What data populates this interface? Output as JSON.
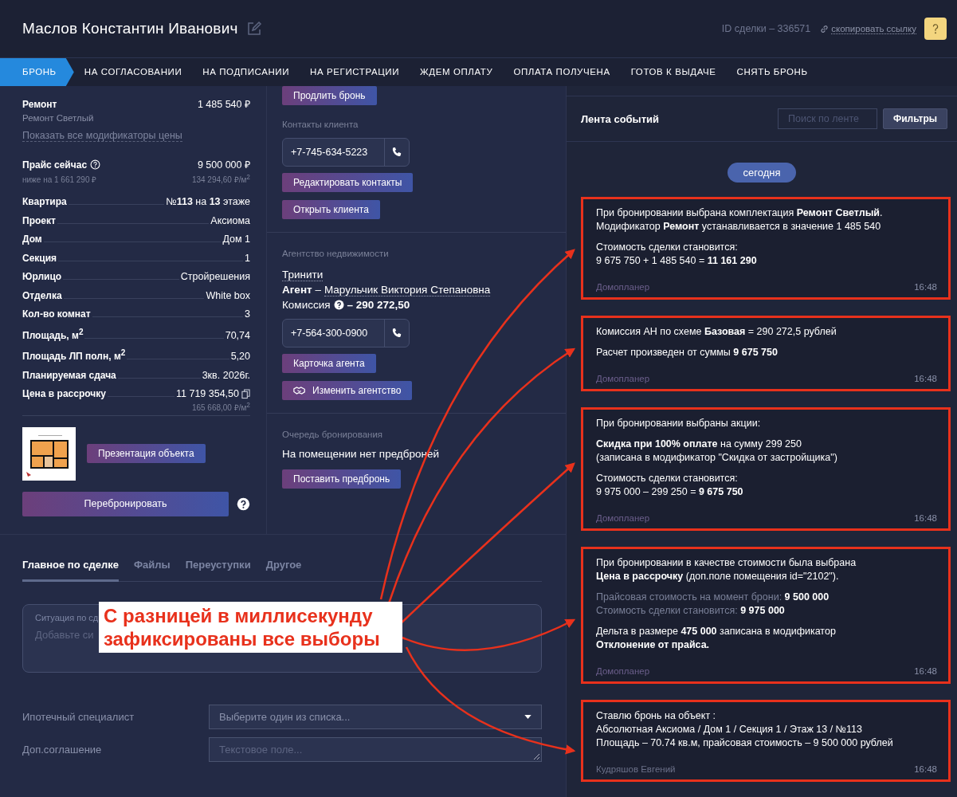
{
  "header": {
    "title": "Маслов Константин Иванович",
    "deal_id": "ID сделки – 336571",
    "copy_link": "скопировать ссылку"
  },
  "stages": [
    {
      "label": "БРОНЬ",
      "selected": true
    },
    {
      "label": "НА СОГЛАСОВАНИИ",
      "selected": false
    },
    {
      "label": "НА ПОДПИСАНИИ",
      "selected": false
    },
    {
      "label": "НА РЕГИСТРАЦИИ",
      "selected": false
    },
    {
      "label": "ЖДЕМ ОПЛАТУ",
      "selected": false
    },
    {
      "label": "ОПЛАТА ПОЛУЧЕНА",
      "selected": false
    },
    {
      "label": "ГОТОВ К ВЫДАЧЕ",
      "selected": false
    },
    {
      "label": "СНЯТЬ БРОНЬ",
      "selected": false
    }
  ],
  "left": {
    "modifier": {
      "label": "Ремонт",
      "value": "1 485 540 ₽",
      "sub": "Ремонт Светлый"
    },
    "show_modifiers": "Показать все модификаторы цены",
    "price": {
      "label": "Прайс сейчас",
      "value": "9 500 000 ₽",
      "note": "ниже на 1 661 290 ₽",
      "per_m2": "134 294,60 ₽/м$^{2}$"
    },
    "properties": [
      {
        "label": "Квартира",
        "value": "№**113** на **13** этаже"
      },
      {
        "label": "Проект",
        "value": "Аксиома"
      },
      {
        "label": "Дом",
        "value": "Дом 1"
      },
      {
        "label": "Секция",
        "value": "1"
      },
      {
        "label": "Юрлицо",
        "value": "Стройрешения"
      },
      {
        "label": "Отделка",
        "value": "White box"
      },
      {
        "label": "Кол-во комнат",
        "value": "3"
      },
      {
        "label": "Площадь, м$^{2}$",
        "value": "70,74"
      },
      {
        "label": "Площадь ЛП полн, м$^{2}$",
        "value": "5,20"
      },
      {
        "label": "Планируемая сдача",
        "value": "3кв. 2026г."
      },
      {
        "label": "Цена в рассрочку",
        "value": "11 719 354,50",
        "copy": true,
        "sub": "165 668,00 ₽/м$^{2}$"
      }
    ],
    "presentation_button": "Презентация объекта",
    "rebook_button": "Перебронировать"
  },
  "middle": {
    "extend_button": "Продлить бронь",
    "client_contacts": {
      "title": "Контакты клиента",
      "phone": "+7-745-634-5223",
      "buttons": [
        "Редактировать контакты",
        "Открыть клиента"
      ]
    },
    "agency": {
      "title": "Агентство недвижимости",
      "name": "Тринити",
      "agent_label": "**Агент** –",
      "agent_name": "Марульчик Виктория Степановна",
      "commission_label": "Комиссия",
      "commission_value": "– 290 272,50",
      "phone": "+7-564-300-0900",
      "card_button": "Карточка агента",
      "change_button": "Изменить агентство"
    },
    "queue": {
      "title": "Очередь бронирования",
      "text": "На помещении нет предброней",
      "button": "Поставить предбронь"
    }
  },
  "bottom": {
    "tabs": [
      {
        "label": "Главное по сделке",
        "selected": true
      },
      {
        "label": "Файлы",
        "selected": false
      },
      {
        "label": "Переуступки",
        "selected": false
      },
      {
        "label": "Другое",
        "selected": false
      }
    ],
    "situation": {
      "label": "Ситуация по сд",
      "placeholder": "Добавьте си"
    },
    "fields": [
      {
        "kind": "select",
        "label": "Ипотечный специалист",
        "placeholder": "Выберите один из списка..."
      },
      {
        "kind": "text",
        "label": "Доп.соглашение",
        "placeholder": "Текстовое поле..."
      }
    ]
  },
  "feed": {
    "title": "Лента событий",
    "search_placeholder": "Поиск по ленте",
    "filters_button": "Фильтры",
    "date": "сегодня",
    "events": [
      {
        "highlighted": true,
        "system": true,
        "author": "Домопланер",
        "time": "16:48",
        "paragraphs": [
          {
            "muted": false,
            "lines": [
              "При бронировании выбрана комплектация **Ремонт Светлый**.",
              "Модификатор **Ремонт** устанавливается в значение 1 485 540"
            ]
          },
          {
            "muted": false,
            "lines": [
              "Стоимость сделки становится:",
              "9 675 750 + 1 485 540 = **11 161 290**"
            ]
          }
        ]
      },
      {
        "highlighted": true,
        "system": true,
        "author": "Домопланер",
        "time": "16:48",
        "paragraphs": [
          {
            "muted": false,
            "lines": [
              "Комиссия АН по схеме **Базовая** = 290 272,5 рублей"
            ]
          },
          {
            "muted": false,
            "lines": [
              "Расчет произведен от суммы **9 675 750**"
            ]
          }
        ]
      },
      {
        "highlighted": true,
        "system": true,
        "author": "Домопланер",
        "time": "16:48",
        "paragraphs": [
          {
            "muted": false,
            "lines": [
              "При бронировании выбраны акции:"
            ]
          },
          {
            "muted": false,
            "lines": [
              "**Скидка при 100% оплате** на сумму 299 250",
              "(записана в модификатор \"Скидка от застройщика\")"
            ]
          },
          {
            "muted": false,
            "lines": [
              "Стоимость сделки становится:",
              "9 975 000 – 299 250 = **9 675 750**"
            ]
          }
        ]
      },
      {
        "highlighted": true,
        "system": true,
        "author": "Домопланер",
        "time": "16:48",
        "paragraphs": [
          {
            "muted": false,
            "lines": [
              "При бронировании в качестве стоимости была выбрана",
              "**Цена в рассрочку** (доп.поле помещения id=\"2102\")."
            ]
          },
          {
            "muted": true,
            "lines": [
              "Прайсовая стоимость на момент брони: **9 500 000**",
              "Стоимость сделки становится: **9 975 000**"
            ]
          },
          {
            "muted": false,
            "lines": [
              "Дельта в размере **475 000** записана в модификатор",
              "**Отклонение от прайса.**"
            ]
          }
        ]
      },
      {
        "highlighted": true,
        "system": false,
        "author": "Кудряшов Евгений",
        "time": "16:48",
        "paragraphs": [
          {
            "muted": false,
            "lines": [
              "Ставлю бронь на объект :",
              "Абсолютная Аксиома / Дом 1 / Секция 1 / Этаж 13 / №113",
              "Площадь – 70.74 кв.м, прайсовая стоимость – 9 500 000 рублей"
            ]
          }
        ]
      }
    ]
  },
  "annotation": {
    "callout": "С разницей в миллисекунду зафиксированы все выборы"
  }
}
